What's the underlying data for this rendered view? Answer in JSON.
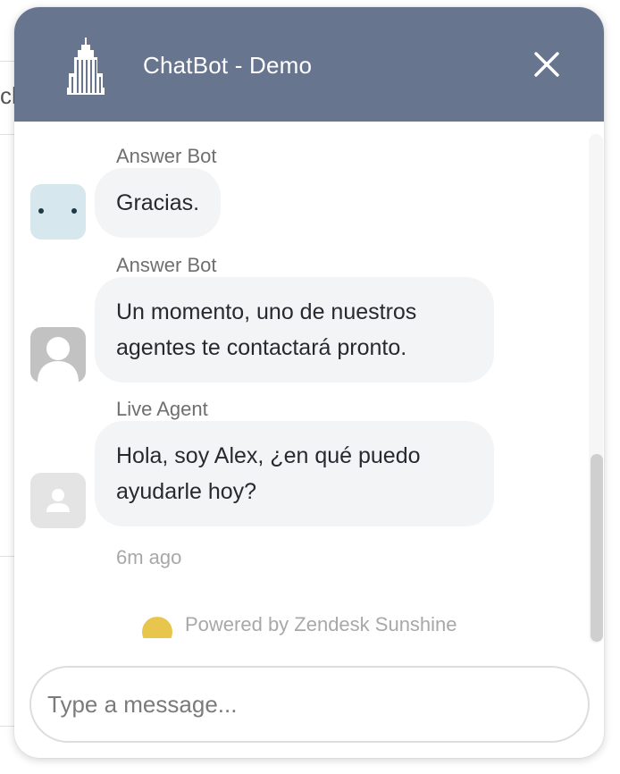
{
  "background": {
    "fragment_text": "ch"
  },
  "header": {
    "title": "ChatBot - Demo",
    "logo_icon": "skyscraper-icon",
    "close_icon": "close-icon"
  },
  "messages": [
    {
      "sender": "Answer Bot",
      "text": "Gracias.",
      "avatar": "bot-face-avatar"
    },
    {
      "sender": "Answer Bot",
      "text": "Un momento, uno de nuestros agentes te contactará pronto.",
      "avatar": "default-user-avatar"
    },
    {
      "sender": "Live Agent",
      "text": "Hola, soy Alex, ¿en qué puedo ayudarle hoy?",
      "avatar": "agent-avatar"
    }
  ],
  "timestamp": "6m ago",
  "footer": {
    "powered_by": "Powered by Zendesk Sunshine"
  },
  "composer": {
    "placeholder": "Type a message..."
  },
  "colors": {
    "header": "#68758f",
    "bubble": "#f3f4f6",
    "brand_sun": "#e8c64d"
  }
}
